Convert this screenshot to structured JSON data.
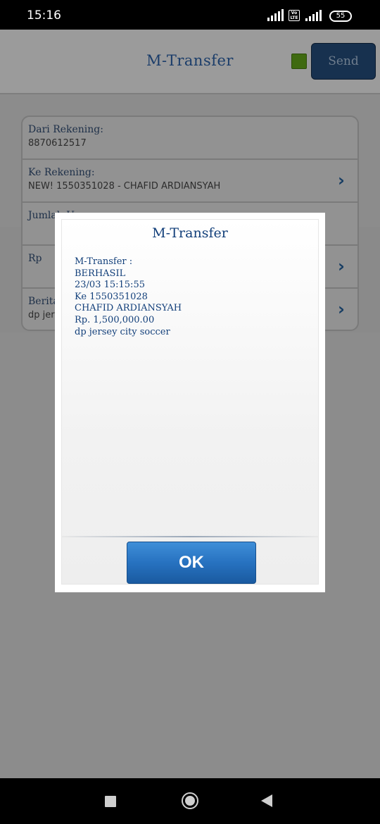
{
  "status_bar": {
    "time": "15:16",
    "volte": "Vo LTE",
    "battery": "55"
  },
  "header": {
    "title": "M-Transfer",
    "send_label": "Send"
  },
  "form": {
    "rows": [
      {
        "label": "Dari Rekening:",
        "value": "8870612517"
      },
      {
        "label": "Ke Rekening:",
        "value": "NEW! 1550351028 - CHAFID ARDIANSYAH"
      },
      {
        "label": "Jumlah Uang:",
        "value": ""
      },
      {
        "label": "Rp",
        "value": ""
      },
      {
        "label": "Berita",
        "value": "dp jer"
      }
    ]
  },
  "dialog": {
    "title": "M-Transfer",
    "message_lines": [
      "M-Transfer :",
      "BERHASIL",
      "23/03 15:15:55",
      "Ke 1550351028",
      "CHAFID ARDIANSYAH",
      "Rp. 1,500,000.00",
      "dp jersey city soccer"
    ],
    "ok_label": "OK"
  },
  "colors": {
    "accent_blue": "#123f7a",
    "ok_button": "#2772c0",
    "status_square": "#3f6a10"
  }
}
